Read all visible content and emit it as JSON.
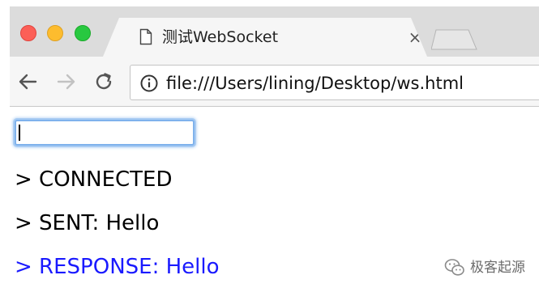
{
  "window": {
    "controls": [
      "close",
      "minimize",
      "zoom"
    ],
    "colors": {
      "close": "#fc5f57",
      "minimize": "#fdbc2e",
      "zoom": "#28c840"
    }
  },
  "tab": {
    "title": "测试WebSocket",
    "icon": "document-icon",
    "close_glyph": "×"
  },
  "toolbar": {
    "back_icon": "arrow-left-icon",
    "forward_icon": "arrow-right-icon",
    "reload_icon": "reload-icon",
    "info_icon": "info-icon",
    "url": "file:///Users/lining/Desktop/ws.html"
  },
  "page": {
    "input": {
      "value": "",
      "placeholder": ""
    },
    "log": [
      {
        "text": "> CONNECTED",
        "color": "#000000"
      },
      {
        "text": "> SENT: Hello",
        "color": "#000000"
      },
      {
        "text": "> RESPONSE: Hello",
        "color": "#1a1aff"
      }
    ]
  },
  "watermark": {
    "text": "极客起源"
  }
}
